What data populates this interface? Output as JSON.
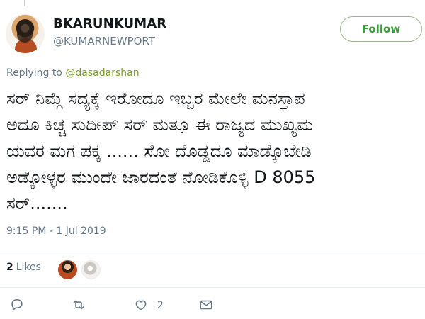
{
  "user": {
    "display_name": "BKARUNKUMAR",
    "handle": "@KUMARNEWPORT",
    "avatar_icon": "profile-photo-avatar"
  },
  "follow": {
    "label": "Follow"
  },
  "reply_context": {
    "prefix": "Replying to ",
    "mention": "@dasadarshan"
  },
  "tweet": {
    "text": "ಸರ್ ನಿಮ್ಗೆ ಸದ್ಯಕ್ಕೆ ಇರೋದೂ ಇಬ್ಬರ ಮೇಲೇ ಮನಸ್ತಾಪ\nಅದೂ ಕಿಚ್ಚ ಸುದೀಪ್ ಸರ್ ಮತ್ತೂ ಈ ರಾಜ್ಯದ ಮುಖ್ಯಮ\nಯವರ ಮಗ ಪಕ್ಕ ...... ಸೋ ದೊಡ್ಡದೂ ಮಾಡ್ಕೊಬೇಡಿ\nಅಡ್ಕೋಳ್ಳರ ಮುಂದೇ ಜಾರದಂತೆ ನೋಡಿಕೊಳ್ಳಿ D 8055\nಸರ್.......",
    "timestamp": "9:15 PM - 1 Jul 2019"
  },
  "engagement": {
    "likes_count": "2",
    "likes_label": "Likes",
    "liker_icons": [
      "liker-avatar-1",
      "liker-avatar-2"
    ]
  },
  "actions": {
    "reply_icon": "reply-icon",
    "retweet_icon": "retweet-icon",
    "like_icon": "like-icon",
    "like_count": "2",
    "message_icon": "message-icon"
  },
  "colors": {
    "brand_green": "#3b9c3b",
    "reply_link_green": "#7b9e2d",
    "muted_text": "#657786",
    "divider": "#e6ecf0"
  }
}
